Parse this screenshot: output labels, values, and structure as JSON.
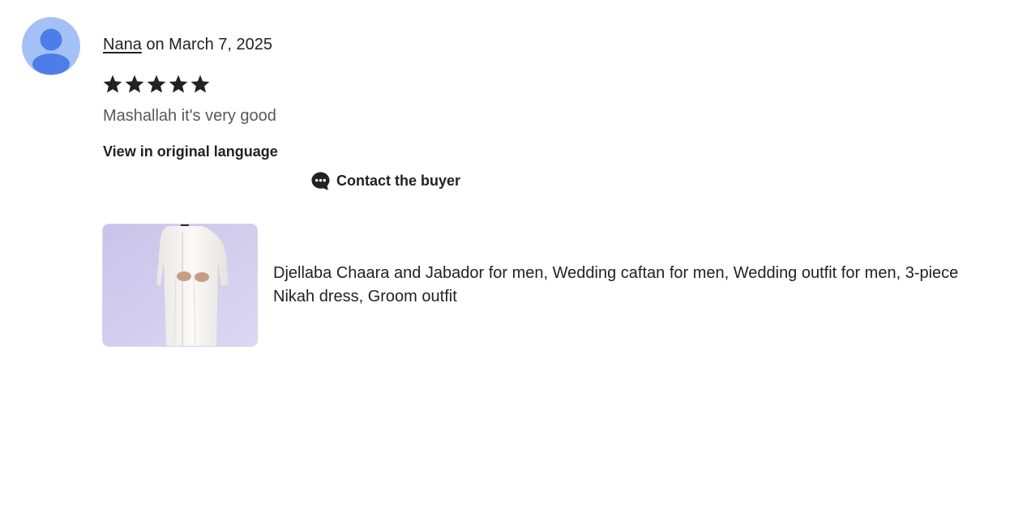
{
  "review": {
    "author": "Nana",
    "date_text": "on March 7, 2025",
    "rating": 5,
    "rating_max": 5,
    "text": "Mashallah it's very good",
    "translate_link": "View in original language",
    "contact_label": "Contact the buyer"
  },
  "item": {
    "title": "Djellaba Chaara and Jabador for men, Wedding caftan for men, Wedding outfit for men, 3-piece Nikah dress, Groom outfit"
  },
  "colors": {
    "avatar_bg": "#a3c0f7",
    "avatar_fg": "#4d7de8",
    "star": "#222222",
    "text_muted": "#595959"
  },
  "icons": {
    "avatar": "person-silhouette-icon",
    "star": "star-icon",
    "contact": "chat-bubble-dots-icon"
  }
}
